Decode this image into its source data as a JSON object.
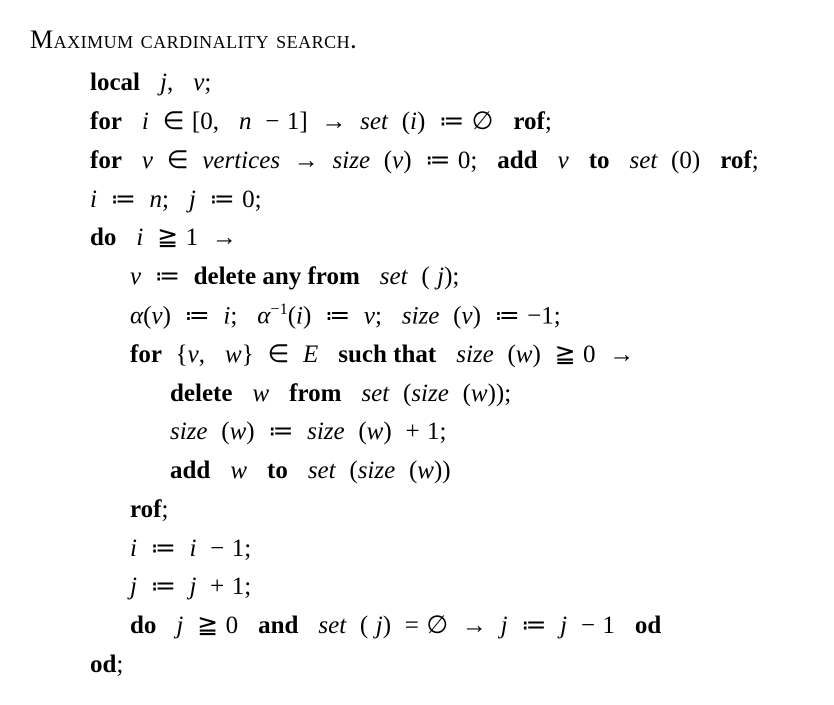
{
  "title": "Maximum cardinality search.",
  "kw": {
    "local": "local",
    "for": "for",
    "rof": "rof",
    "add": "add",
    "to": "to",
    "do": "do",
    "od": "od",
    "delete_any_from": "delete any from",
    "delete": "delete",
    "from": "from",
    "such_that": "such that",
    "and": "and"
  },
  "var": {
    "j": "j",
    "v": "v",
    "i": "i",
    "n": "n",
    "w": "w",
    "E": "E",
    "vertices": "vertices"
  },
  "fn": {
    "set": "set",
    "size": "size",
    "alpha": "α",
    "alpha_inv": "α"
  },
  "sym": {
    "empty": "∅",
    "in": "∈",
    "arrow": "→",
    "assign": "≔",
    "geq": "≧",
    "lbrace": "{",
    "rbrace": "}",
    "lbrack": "[",
    "rbrack": "]"
  },
  "txt": {
    "comma": ",",
    "semicolon": ";",
    "zero": "0",
    "one": "1",
    "minus": "−",
    "plus": "+",
    "neg1": "−1",
    "eq": "=",
    "lparen": "(",
    "rparen": ")",
    "sup_neg1": "−1"
  }
}
